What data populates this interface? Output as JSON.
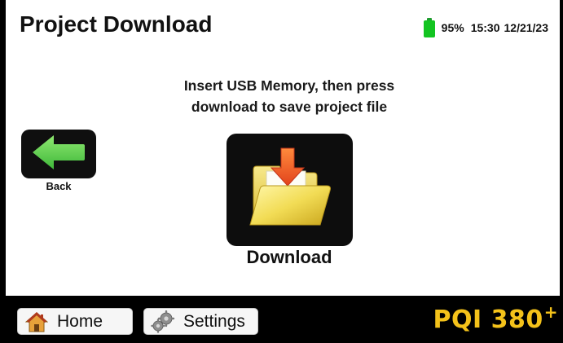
{
  "header": {
    "title": "Project Download",
    "battery_percent": "95%",
    "battery_level": 0.95,
    "time": "15:30",
    "date": "12/21/23",
    "battery_icon": "battery-icon",
    "battery_color": "#13c421"
  },
  "main": {
    "instruction_line1": "Insert USB Memory, then press",
    "instruction_line2": "download to save project file",
    "back_label": "Back",
    "back_icon": "arrow-left-icon",
    "back_icon_color": "#5ed64e",
    "download_label": "Download",
    "download_icon": "folder-download-icon"
  },
  "footer": {
    "home_label": "Home",
    "home_icon": "home-icon",
    "settings_label": "Settings",
    "settings_icon": "gears-icon",
    "brand_text": "PQI 380",
    "brand_sup": "+",
    "brand_color": "#f4c21a"
  }
}
